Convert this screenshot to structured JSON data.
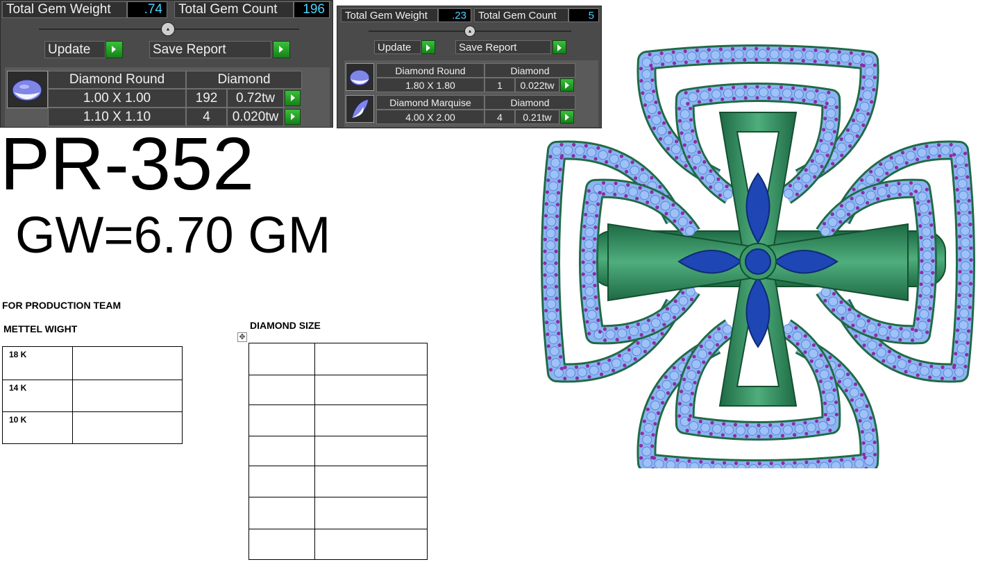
{
  "panel_left": {
    "total_gem_weight_label": "Total Gem Weight",
    "total_gem_weight": ".74",
    "total_gem_count_label": "Total Gem Count",
    "total_gem_count": "196",
    "update_label": "Update",
    "save_report_label": "Save Report",
    "gems": [
      {
        "name": "Diamond Round",
        "material": "Diamond",
        "rows": [
          {
            "size": "1.00 X 1.00",
            "count": "192",
            "weight": "0.72tw"
          },
          {
            "size": "1.10 X 1.10",
            "count": "4",
            "weight": "0.020tw"
          }
        ]
      }
    ]
  },
  "panel_right": {
    "total_gem_weight_label": "Total Gem Weight",
    "total_gem_weight": ".23",
    "total_gem_count_label": "Total Gem Count",
    "total_gem_count": "5",
    "update_label": "Update",
    "save_report_label": "Save Report",
    "gems": [
      {
        "name": "Diamond Round",
        "material": "Diamond",
        "size": "1.80 X 1.80",
        "count": "1",
        "weight": "0.022tw"
      },
      {
        "name": "Diamond Marquise",
        "material": "Diamond",
        "size": "4.00 X 2.00",
        "count": "4",
        "weight": "0.21tw"
      }
    ]
  },
  "product_code": "PR-352",
  "gross_weight": "GW=6.70 GM",
  "production_note": "FOR PRODUCTION TEAM",
  "metal_weight_title": "METTEL WIGHT",
  "metal_weight_rows": [
    "18 K",
    "14 K",
    "10 K"
  ],
  "diamond_size_title": "DIAMOND SIZE",
  "colors": {
    "panel_bg": "#4a4a4a",
    "value_text": "#4fd2ff",
    "go_button": "#22a022",
    "metal_green": "#2f8a5a",
    "stone_light": "#8cb4f2",
    "stone_dark": "#1e46b4",
    "prong": "#8a2ea0"
  },
  "icons": [
    "round-gem-icon",
    "marquise-gem-icon",
    "play-arrow-icon",
    "move-handle-icon"
  ]
}
